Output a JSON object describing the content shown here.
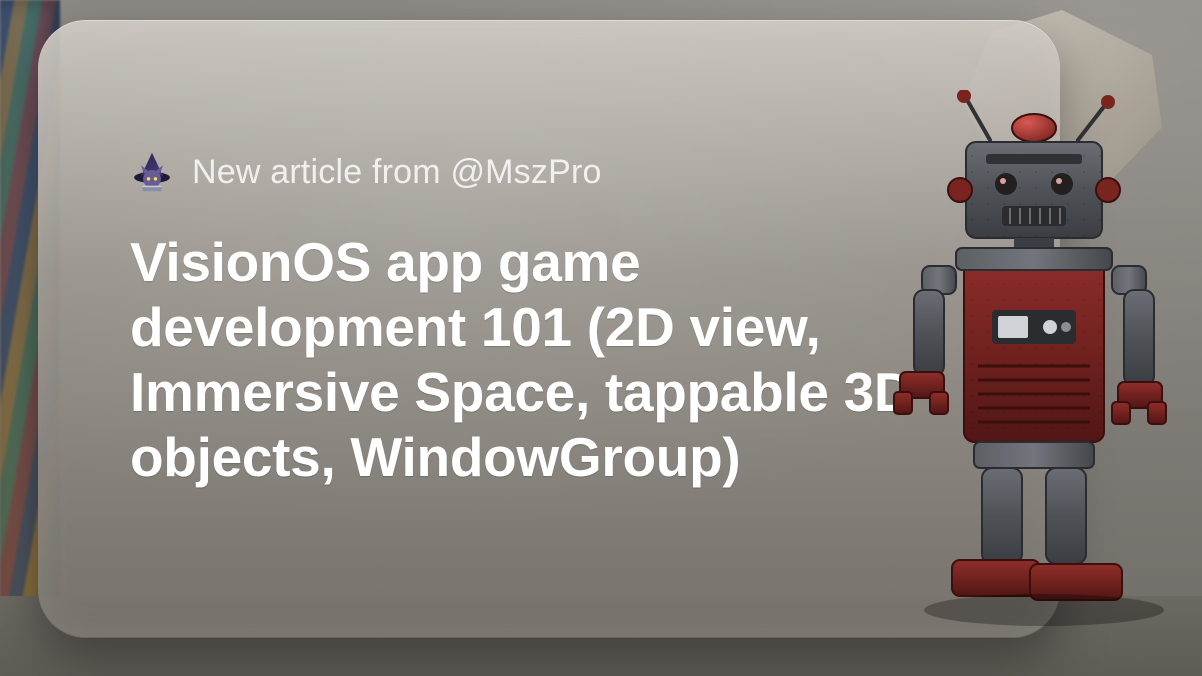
{
  "card": {
    "subhead": "New article from @MszPro",
    "title": "VisionOS app game development 101 (2D view, Immersive Space, tappable 3D objects, WindowGroup)"
  },
  "icons": {
    "avatar": "wizard-cat-avatar",
    "robot": "toy-robot-illustration",
    "polyhedron": "rock-polyhedron"
  }
}
